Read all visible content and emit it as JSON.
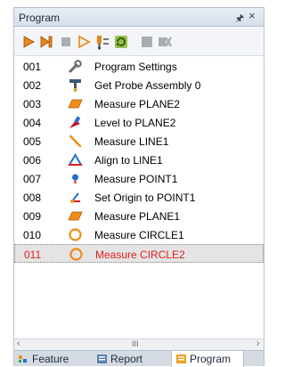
{
  "panel": {
    "title": "Program",
    "pin_glyph": "Ũ",
    "close_glyph": "×"
  },
  "toolbar": {
    "buttons": [
      {
        "name": "run-icon"
      },
      {
        "name": "step-icon"
      },
      {
        "name": "stop-icon"
      },
      {
        "name": "run-from-cursor-icon"
      },
      {
        "name": "probe-icon"
      },
      {
        "name": "refresh-icon"
      },
      {
        "name": "block-icon"
      },
      {
        "name": "delete-icon"
      }
    ]
  },
  "program": {
    "rows": [
      {
        "num": "001",
        "label": "Program Settings",
        "icon": "wrench-icon"
      },
      {
        "num": "002",
        "label": "Get Probe Assembly 0",
        "icon": "probe-assembly-icon"
      },
      {
        "num": "003",
        "label": "Measure PLANE2",
        "icon": "plane-icon"
      },
      {
        "num": "004",
        "label": "Level to PLANE2",
        "icon": "level-icon"
      },
      {
        "num": "005",
        "label": "Measure LINE1",
        "icon": "line-icon"
      },
      {
        "num": "006",
        "label": "Align to LINE1",
        "icon": "align-icon"
      },
      {
        "num": "007",
        "label": "Measure POINT1",
        "icon": "point-icon"
      },
      {
        "num": "008",
        "label": "Set Origin to POINT1",
        "icon": "origin-icon"
      },
      {
        "num": "009",
        "label": "Measure PLANE1",
        "icon": "plane-icon"
      },
      {
        "num": "010",
        "label": "Measure CIRCLE1",
        "icon": "circle-icon"
      },
      {
        "num": "011",
        "label": "Measure CIRCLE2",
        "icon": "circle-icon"
      }
    ],
    "selected_index": 10
  },
  "scrollbar": {
    "left_arrow": "‹",
    "right_arrow": "›",
    "grip": "III"
  },
  "tabs": [
    {
      "label": "Feature",
      "icon": "feature-icon"
    },
    {
      "label": "Report",
      "icon": "report-icon"
    },
    {
      "label": "Program",
      "icon": "program-icon",
      "active": true
    }
  ],
  "colors": {
    "selected_text": "#e02020",
    "accent": "#f08c1a"
  }
}
